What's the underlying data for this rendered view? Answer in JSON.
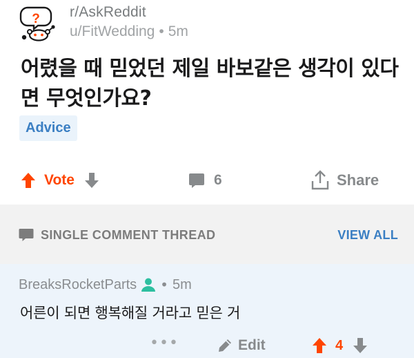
{
  "post": {
    "subreddit": "r/AskReddit",
    "author": "u/FitWedding",
    "separator": "•",
    "age": "5m",
    "title": "어렸을 때 믿었던 제일 바보같은 생각이 있다면 무엇인가요?",
    "flair": "Advice",
    "vote_label": "Vote",
    "comment_count": "6",
    "share_label": "Share"
  },
  "thread": {
    "label": "SINGLE COMMENT THREAD",
    "view_all": "VIEW ALL"
  },
  "comment": {
    "author": "BreaksRocketParts",
    "separator": "•",
    "age": "5m",
    "body": "어른이 되면 행복해질 거라고 믿은 거",
    "more": "•••",
    "edit_label": "Edit",
    "score": "4"
  },
  "colors": {
    "upvote": "#ff4500",
    "link_blue": "#3b7fc3",
    "comment_bg": "#edf4fb",
    "band_bg": "#f2f2f2",
    "flair_bg": "#eaf3fb",
    "user_icon": "#2dbfa0"
  },
  "icons": {
    "subreddit": "askreddit-snoo-icon",
    "upvote": "arrow-up-icon",
    "downvote": "arrow-down-icon",
    "comments": "comment-bubble-icon",
    "share": "share-icon",
    "thread": "comment-thread-icon",
    "user": "user-icon",
    "edit": "pencil-icon"
  }
}
